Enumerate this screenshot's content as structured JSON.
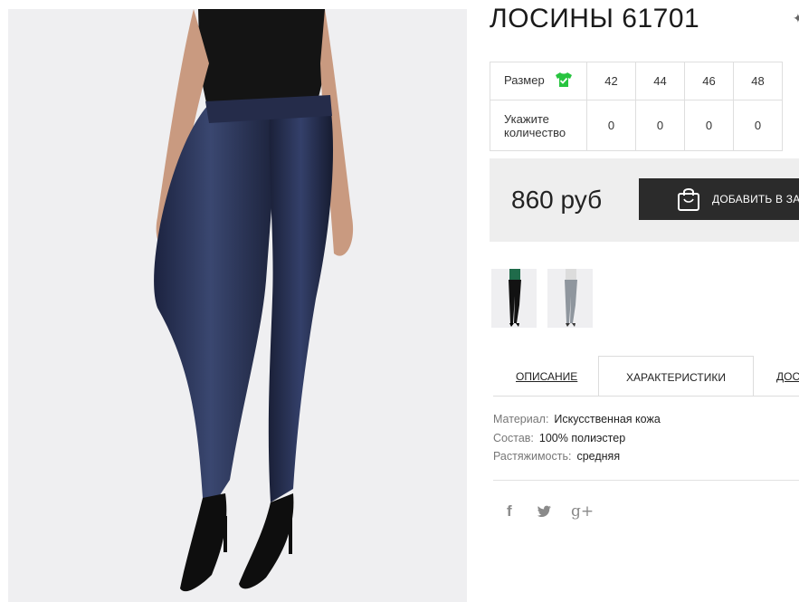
{
  "product": {
    "title": "ЛОСИНЫ 61701",
    "price": "860 руб"
  },
  "size_table": {
    "size_label": "Размер",
    "quantity_label": "Укажите количество",
    "sizes": [
      "42",
      "44",
      "46",
      "48"
    ],
    "quantities": [
      "0",
      "0",
      "0",
      "0"
    ]
  },
  "cart": {
    "label": "ДОБАВИТЬ В ЗА"
  },
  "thumbnails": [
    {
      "icon": "product-thumbnail-black-leggings"
    },
    {
      "icon": "product-thumbnail-grey-leggings"
    }
  ],
  "tabs": {
    "description": "ОПИСАНИЕ",
    "characteristics": "ХАРАКТЕРИСТИКИ",
    "delivery": "ДОС"
  },
  "specs": [
    {
      "key": "Материал:",
      "value": "Искусственная кожа"
    },
    {
      "key": "Состав:",
      "value": "100% полиэстер"
    },
    {
      "key": "Растяжимость:",
      "value": "средняя"
    }
  ],
  "social": {
    "facebook": "f",
    "twitter": "🐦",
    "googleplus": "g+"
  },
  "colors": {
    "accent_green": "#27c43f",
    "cart_button": "#2b2b2b",
    "panel_bg": "#eeeeee",
    "leggings_navy": "#27304f"
  }
}
